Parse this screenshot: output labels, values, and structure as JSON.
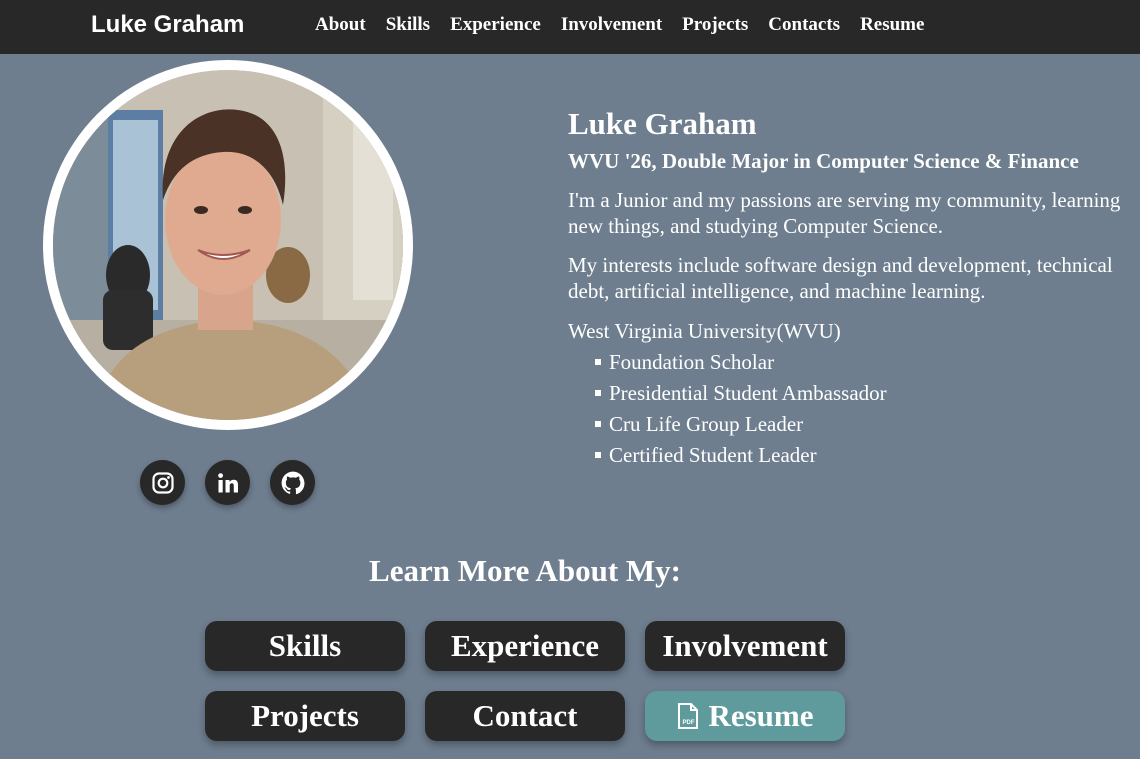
{
  "nav": {
    "brand": "Luke Graham",
    "links": [
      "About",
      "Skills",
      "Experience",
      "Involvement",
      "Projects",
      "Contacts",
      "Resume"
    ]
  },
  "profile": {
    "photo_alt": "Profile photo of Luke Graham",
    "socials": [
      "instagram-icon",
      "linkedin-icon",
      "github-icon"
    ]
  },
  "bio": {
    "name": "Luke Graham",
    "subtitle": "WVU '26, Double Major in Computer Science & Finance",
    "paragraph1": "I'm a Junior and my passions are serving my community, learning new things, and studying Computer Science.",
    "paragraph2": "My interests include software design and development, technical debt, artificial intelligence, and machine learning.",
    "school": "West Virginia University(WVU)",
    "achievements": [
      "Foundation Scholar",
      "Presidential Student Ambassador",
      "Cru Life Group Leader",
      "Certified Student Leader"
    ]
  },
  "learn_more": {
    "title": "Learn More About My:",
    "buttons": [
      "Skills",
      "Experience",
      "Involvement",
      "Projects",
      "Contact",
      "Resume"
    ],
    "resume_icon": "pdf-file-icon"
  },
  "colors": {
    "background": "#6e7e8f",
    "navbar": "#282828",
    "button": "#282828",
    "resume_button": "#5f9a9d",
    "text": "#ffffff"
  }
}
